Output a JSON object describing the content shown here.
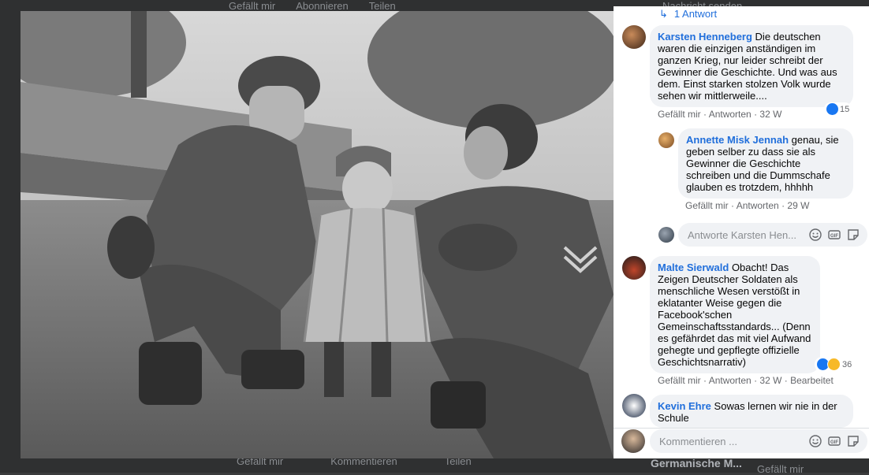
{
  "background": {
    "top_actions": [
      "Gefällt mir",
      "Abonnieren",
      "Teilen"
    ],
    "top_send": "Nachricht senden",
    "bottom_actions": [
      "Gefällt mir",
      "Kommentieren",
      "Teilen"
    ],
    "bottom_page_name": "Germanische M...",
    "bottom_like": "Gefällt mir"
  },
  "thread": {
    "reply_count": "1 Antwort"
  },
  "comments": [
    {
      "author": "Karsten Henneberg",
      "text": "Die deutschen waren die einzigen anständigen im ganzen Krieg, nur leider schreibt der Gewinner die Geschichte. Und was aus dem. Einst starken stolzen Volk wurde sehen wir mittlerweile....",
      "like_label": "Gefällt mir",
      "reply_label": "Antworten",
      "time": "32 W",
      "reaction_count": "15"
    },
    {
      "author": "Annette Misk Jennah",
      "text": "genau, sie geben selber zu dass sie als Gewinner die Geschichte schreiben und die Dummschafe glauben es trotzdem, hhhhh",
      "like_label": "Gefällt mir",
      "reply_label": "Antworten",
      "time": "29 W"
    },
    {
      "author": "Malte Sierwald",
      "text": "Obacht! Das Zeigen Deutscher Soldaten als menschliche Wesen verstößt in eklatanter Weise gegen die Facebook'schen Gemeinschaftsstandards... (Denn es gefährdet das mit viel Aufwand gehegte und gepflegte offizielle Geschichtsnarrativ)",
      "like_label": "Gefällt mir",
      "reply_label": "Antworten",
      "time": "32 W",
      "edited": "Bearbeitet",
      "reaction_count": "36"
    },
    {
      "author": "Kevin Ehre",
      "text": "Sowas lernen wir nie in der Schule"
    }
  ],
  "reply_input": {
    "placeholder": "Antworte Karsten Hen..."
  },
  "comment_input": {
    "placeholder": "Kommentieren ..."
  },
  "icons": [
    "emoji-icon",
    "gif-icon",
    "sticker-icon",
    "like-reaction-icon",
    "sad-reaction-icon",
    "reply-arrow-icon"
  ],
  "colors": {
    "link_blue": "#216fdb",
    "bubble_bg": "#f0f2f5",
    "meta_gray": "#65676b",
    "like_blue": "#1877f2",
    "sad_yellow": "#f7b928"
  }
}
